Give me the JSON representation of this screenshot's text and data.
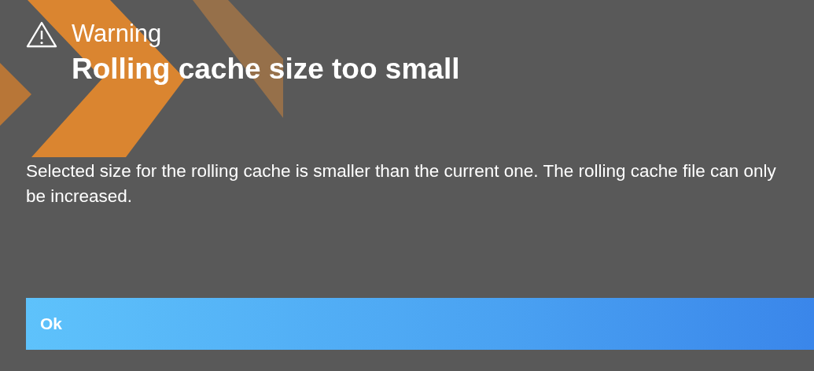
{
  "dialog": {
    "kind": "warning",
    "severity": "Warning",
    "title": "Rolling cache size too small",
    "message": "Selected size for the rolling cache is smaller than the current one. The rolling cache file can only be increased.",
    "buttons": [
      "Ok"
    ]
  }
}
